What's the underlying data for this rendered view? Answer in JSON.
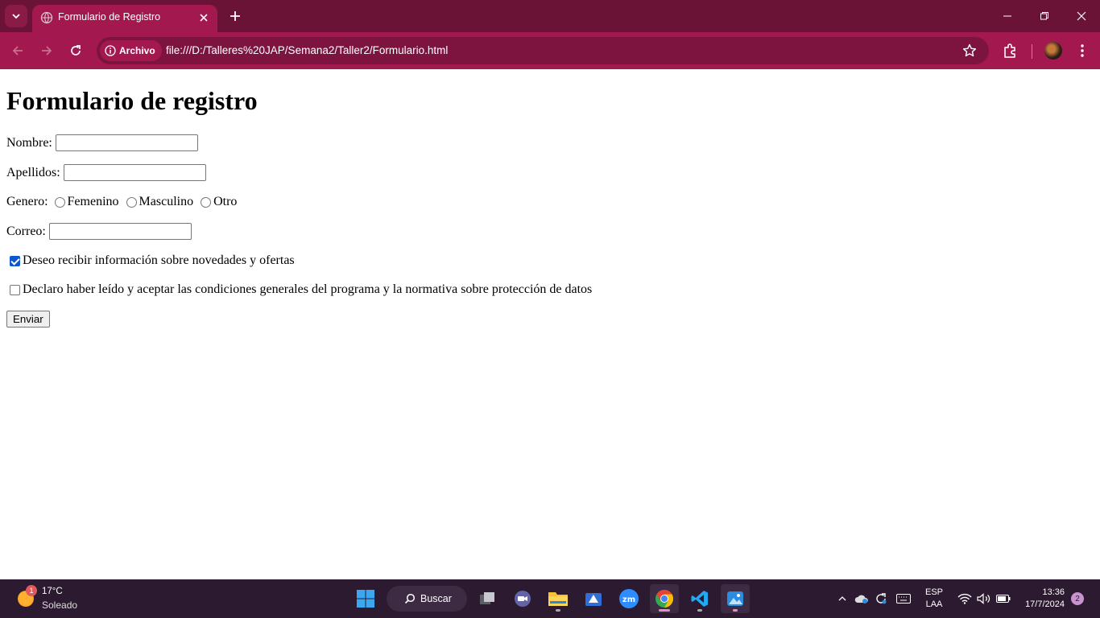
{
  "browser": {
    "tab_title": "Formulario de Registro",
    "site_chip": "Archivo",
    "url": "file:///D:/Talleres%20JAP/Semana2/Taller2/Formulario.html",
    "accent": "#a3194f"
  },
  "form": {
    "heading": "Formulario de registro",
    "nombre_label": "Nombre:",
    "nombre_value": "",
    "apellidos_label": "Apellidos:",
    "apellidos_value": "",
    "genero_label": "Genero:",
    "genero_options": [
      "Femenino",
      "Masculino",
      "Otro"
    ],
    "correo_label": "Correo:",
    "correo_value": "",
    "newsletter_label": "Deseo recibir información sobre novedades y ofertas",
    "newsletter_checked": true,
    "terms_label": "Declaro haber leído y aceptar las condiciones generales del programa y la normativa sobre protección de datos",
    "terms_checked": false,
    "submit_label": "Enviar"
  },
  "taskbar": {
    "weather_badge": "1",
    "temperature": "17°C",
    "condition": "Soleado",
    "search_label": "Buscar",
    "lang_top": "ESP",
    "lang_bottom": "LAA",
    "time": "13:36",
    "date": "17/7/2024",
    "notifications": "2"
  }
}
